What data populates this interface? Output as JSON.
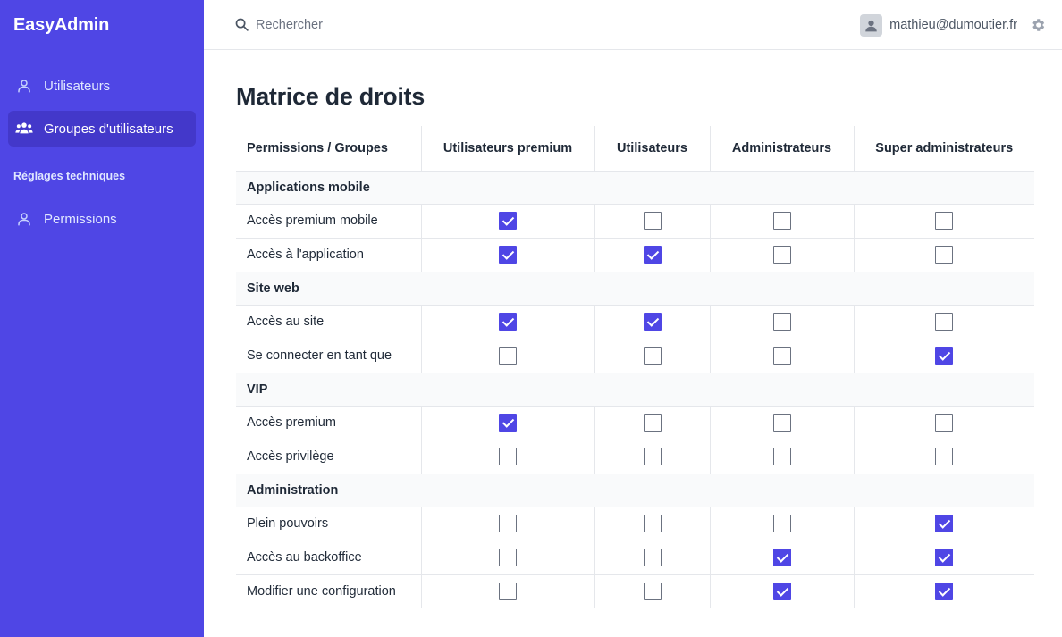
{
  "app": {
    "brand": "EasyAdmin"
  },
  "sidebar": {
    "items": [
      {
        "label": "Utilisateurs",
        "icon": "user-icon",
        "active": false
      },
      {
        "label": "Groupes d'utilisateurs",
        "icon": "users-group-icon",
        "active": true
      }
    ],
    "section_title": "Réglages techniques",
    "section_items": [
      {
        "label": "Permissions",
        "icon": "user-icon",
        "active": false
      }
    ]
  },
  "topbar": {
    "search_placeholder": "Rechercher",
    "search_value": "",
    "user_email": "mathieu@dumoutier.fr",
    "icons": [
      "search-icon",
      "avatar-icon",
      "gear-icon"
    ]
  },
  "main": {
    "title": "Matrice de droits",
    "headers": [
      "Permissions / Groupes",
      "Utilisateurs premium",
      "Utilisateurs",
      "Administrateurs",
      "Super administrateurs"
    ],
    "groups": [
      {
        "name": "Applications mobile",
        "rows": [
          {
            "label": "Accès premium mobile",
            "checks": [
              true,
              false,
              false,
              false
            ]
          },
          {
            "label": "Accès à l'application",
            "checks": [
              true,
              true,
              false,
              false
            ]
          }
        ]
      },
      {
        "name": "Site web",
        "rows": [
          {
            "label": "Accès au site",
            "checks": [
              true,
              true,
              false,
              false
            ]
          },
          {
            "label": "Se connecter en tant que",
            "checks": [
              false,
              false,
              false,
              true
            ]
          }
        ]
      },
      {
        "name": "VIP",
        "rows": [
          {
            "label": "Accès premium",
            "checks": [
              true,
              false,
              false,
              false
            ]
          },
          {
            "label": "Accès privilège",
            "checks": [
              false,
              false,
              false,
              false
            ]
          }
        ]
      },
      {
        "name": "Administration",
        "rows": [
          {
            "label": "Plein pouvoirs",
            "checks": [
              false,
              false,
              false,
              true
            ]
          },
          {
            "label": "Accès au backoffice",
            "checks": [
              false,
              false,
              true,
              true
            ]
          },
          {
            "label": "Modifier une configuration",
            "checks": [
              false,
              false,
              true,
              true
            ]
          }
        ]
      }
    ]
  },
  "colors": {
    "accent": "#4f46e5",
    "accent_dark": "#4338ca"
  }
}
